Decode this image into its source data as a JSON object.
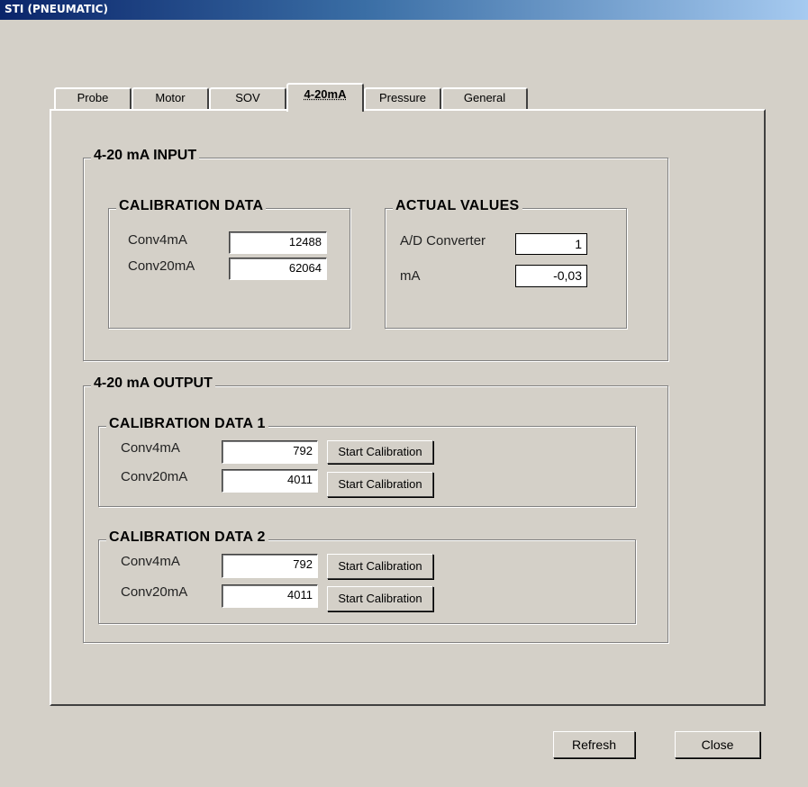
{
  "window": {
    "title": "STI (PNEUMATIC)"
  },
  "tabs": [
    {
      "label": "Probe"
    },
    {
      "label": "Motor"
    },
    {
      "label": "SOV"
    },
    {
      "label": "4-20mA"
    },
    {
      "label": "Pressure"
    },
    {
      "label": "General"
    }
  ],
  "input_group": {
    "title": "4-20 mA INPUT",
    "calibration": {
      "title": "CALIBRATION DATA",
      "conv4_label": "Conv4mA",
      "conv4_value": "12488",
      "conv20_label": "Conv20mA",
      "conv20_value": "62064"
    },
    "actual": {
      "title": "ACTUAL VALUES",
      "ad_label": "A/D Converter",
      "ad_value": "1",
      "ma_label": "mA",
      "ma_value": "-0,03"
    }
  },
  "output_group": {
    "title": "4-20 mA OUTPUT",
    "cal1": {
      "title": "CALIBRATION DATA 1",
      "conv4_label": "Conv4mA",
      "conv4_value": "792",
      "conv20_label": "Conv20mA",
      "conv20_value": "4011",
      "start_label": "Start Calibration"
    },
    "cal2": {
      "title": "CALIBRATION DATA 2",
      "conv4_label": "Conv4mA",
      "conv4_value": "792",
      "conv20_label": "Conv20mA",
      "conv20_value": "4011",
      "start_label": "Start Calibration"
    }
  },
  "footer": {
    "refresh_label": "Refresh",
    "close_label": "Close"
  }
}
